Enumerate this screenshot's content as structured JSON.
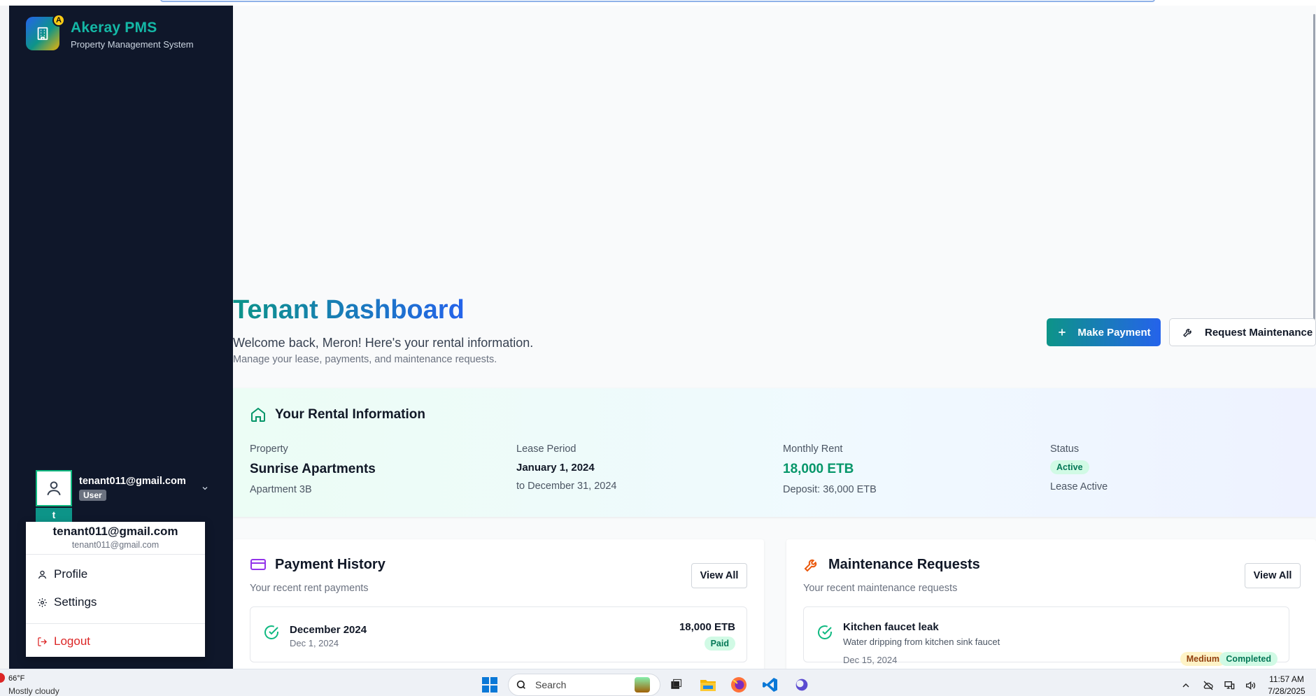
{
  "brand": {
    "name": "Akeray PMS",
    "subtitle": "Property Management System",
    "badge": "A"
  },
  "user": {
    "email": "tenant011@gmail.com",
    "role": "User",
    "avatar_letter": "t"
  },
  "user_menu": {
    "name": "tenant011@gmail.com",
    "email": "tenant011@gmail.com",
    "items": [
      {
        "label": "Profile",
        "icon": "user-icon"
      },
      {
        "label": "Settings",
        "icon": "gear-icon"
      }
    ],
    "logout": "Logout"
  },
  "header": {
    "title": "Tenant Dashboard",
    "welcome": "Welcome back, Meron! Here's your rental information.",
    "subtitle": "Manage your lease, payments, and maintenance requests.",
    "make_payment": "Make Payment",
    "request_maintenance": "Request Maintenance"
  },
  "rental": {
    "title": "Your Rental Information",
    "property": {
      "label": "Property",
      "value": "Sunrise Apartments",
      "sub": "Apartment 3B"
    },
    "lease": {
      "label": "Lease Period",
      "value": "January 1, 2024",
      "sub": "to December 31, 2024"
    },
    "rent": {
      "label": "Monthly Rent",
      "value": "18,000 ETB",
      "sub": "Deposit: 36,000 ETB"
    },
    "status": {
      "label": "Status",
      "value": "Active",
      "sub": "Lease Active"
    }
  },
  "payments": {
    "title": "Payment History",
    "subtitle": "Your recent rent payments",
    "view_all": "View All",
    "items": [
      {
        "month": "December 2024",
        "date": "Dec 1, 2024",
        "amount": "18,000 ETB",
        "status": "Paid"
      }
    ]
  },
  "maintenance": {
    "title": "Maintenance Requests",
    "subtitle": "Your recent maintenance requests",
    "view_all": "View All",
    "items": [
      {
        "title": "Kitchen faucet leak",
        "description": "Water dripping from kitchen sink faucet",
        "date": "Dec 15, 2024",
        "priority": "Medium",
        "status": "Completed"
      }
    ]
  },
  "taskbar": {
    "weather_temp": "66°F",
    "weather_desc": "Mostly cloudy",
    "search_placeholder": "Search",
    "time": "11:57 AM",
    "date": "7/28/2025"
  },
  "colors": {
    "accent_teal": "#0d9488",
    "accent_blue": "#2563eb",
    "sidebar_bg": "#0f172a",
    "danger": "#dc2626"
  }
}
